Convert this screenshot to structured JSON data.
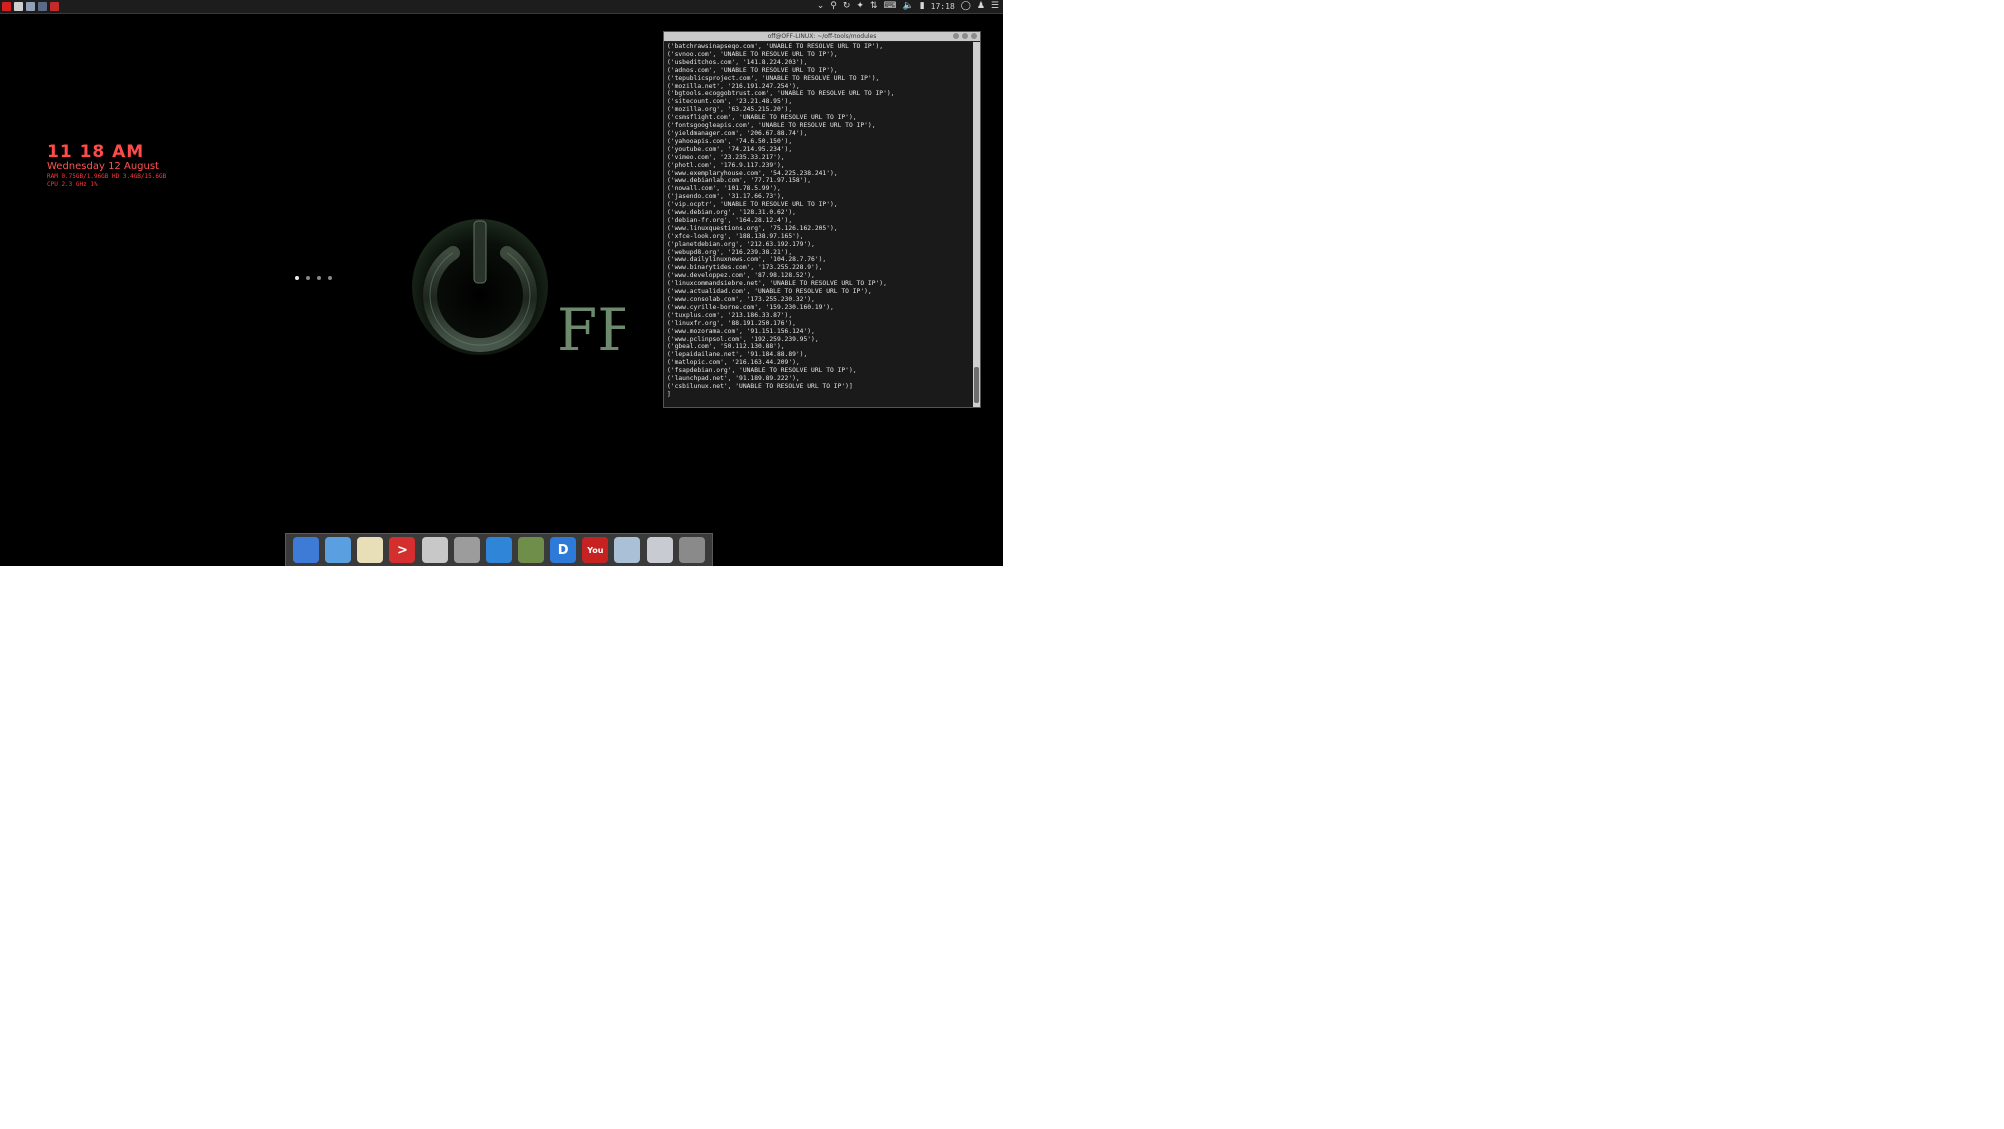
{
  "panel": {
    "left_icons": [
      {
        "name": "menu-icon",
        "color": "#d62020"
      },
      {
        "name": "star-icon",
        "color": "#cfcfcf"
      },
      {
        "name": "files-icon",
        "color": "#8fa0b8"
      },
      {
        "name": "terminal-launcher-icon",
        "color": "#5a6b85"
      },
      {
        "name": "red-app-icon",
        "color": "#c42a2a"
      }
    ],
    "clock": "17:18"
  },
  "conky": {
    "time": "11 18 AM",
    "date": "Wednesday 12 August",
    "line1": "RAM 0.75GB/1.96GB   HD 3.4GB/15.6GB",
    "line2": "CPU 2.3 GHz 1%"
  },
  "logo": {
    "text": "FF"
  },
  "terminal": {
    "title": "off@OFF-LINUX: ~/off-tools/modules",
    "lines": [
      "('batchrawsinapseqo.com', 'UNABLE TO RESOLVE URL TO IP'),",
      "('svnoo.com', 'UNABLE TO RESOLVE URL TO IP'),",
      "('usbeditchos.com', '141.8.224.203'),",
      "('adnos.com', 'UNABLE TO RESOLVE URL TO IP'),",
      "('tepublicsproject.com', 'UNABLE TO RESOLVE URL TO IP'),",
      "('mozilla.net', '216.191.247.254'),",
      "('bgtools.ecoggobtrust.com', 'UNABLE TO RESOLVE URL TO IP'),",
      "('sitecount.com', '23.21.48.95'),",
      "('mozilla.org', '63.245.215.20'),",
      "('csmsflight.com', 'UNABLE TO RESOLVE URL TO IP'),",
      "('fontsgoogleapis.com', 'UNABLE TO RESOLVE URL TO IP'),",
      "('yieldmanager.com', '206.67.88.74'),",
      "('yahooapis.com', '74.6.50.150'),",
      "('youtube.com', '74.214.95.234'),",
      "('vimeo.com', '23.235.33.217'),",
      "('photl.com', '176.9.117.239'),",
      "('www.exemplaryhouse.com', '54.225.238.241'),",
      "('www.debianlab.com', '77.71.97.158'),",
      "('nowall.com', '101.78.5.99'),",
      "('jasendo.com', '31.17.66.73'),",
      "('vip.ocptr', 'UNABLE TO RESOLVE URL TO IP'),",
      "('www.debian.org', '128.31.0.62'),",
      "('debian-fr.org', '164.28.12.4'),",
      "('www.linuxquestions.org', '75.126.162.205'),",
      "('xfce-look.org', '188.138.97.165'),",
      "('planetdebian.org', '212.63.192.179'),",
      "('webupd8.org', '216.239.38.21'),",
      "('www.dailylinuxnews.com', '104.28.7.76'),",
      "('www.binarytides.com', '173.255.228.9'),",
      "('www.developpez.com', '87.98.128.52'),",
      "('linuxcommandsiebre.net', 'UNABLE TO RESOLVE URL TO IP'),",
      "('www.actualidad.com', 'UNABLE TO RESOLVE URL TO IP'),",
      "('www.consolab.com', '173.255.230.32'),",
      "('www.cyrille-borne.com', '159.230.160.19'),",
      "('tuxplus.com', '213.186.33.87'),",
      "('linuxfr.org', '88.191.250.176'),",
      "('www.mozorama.com', '91.151.156.124'),",
      "('www.pclinpsol.com', '192.259.239.95'),",
      "('gbeal.com', '50.112.130.88'),",
      "('lepaidailane.net', '91.184.88.89'),",
      "('matlopic.com', '216.163.44.209'),",
      "('fsapdebian.org', 'UNABLE TO RESOLVE URL TO IP'),",
      "('launchpad.net', '91.189.89.222'),",
      "('csbilunux.net', 'UNABLE TO RESOLVE URL TO IP')]"
    ],
    "prompt": "]"
  },
  "dock": [
    {
      "name": "web-browser-icon",
      "label": "",
      "bg": "#3d7bd6"
    },
    {
      "name": "finder-icon",
      "label": "",
      "bg": "#5aa0e0"
    },
    {
      "name": "notes-icon",
      "label": "",
      "bg": "#e8dfb8"
    },
    {
      "name": "terminal-icon",
      "label": ">",
      "bg": "#d42e2e"
    },
    {
      "name": "mail-icon",
      "label": "",
      "bg": "#c8c8c8"
    },
    {
      "name": "launchpad-icon",
      "label": "",
      "bg": "#9c9c9c"
    },
    {
      "name": "desktop-icon",
      "label": "",
      "bg": "#2f86d8"
    },
    {
      "name": "widgets-icon",
      "label": "",
      "bg": "#6e8e4a"
    },
    {
      "name": "dictionary-icon",
      "label": "D",
      "bg": "#2d7ad8"
    },
    {
      "name": "youtube-icon",
      "label": "You",
      "bg": "#c62222"
    },
    {
      "name": "screenshot-icon",
      "label": "",
      "bg": "#a9c0d6"
    },
    {
      "name": "settings-icon",
      "label": "",
      "bg": "#c8ccd2"
    },
    {
      "name": "trash-icon",
      "label": "",
      "bg": "#8a8a8a"
    }
  ]
}
